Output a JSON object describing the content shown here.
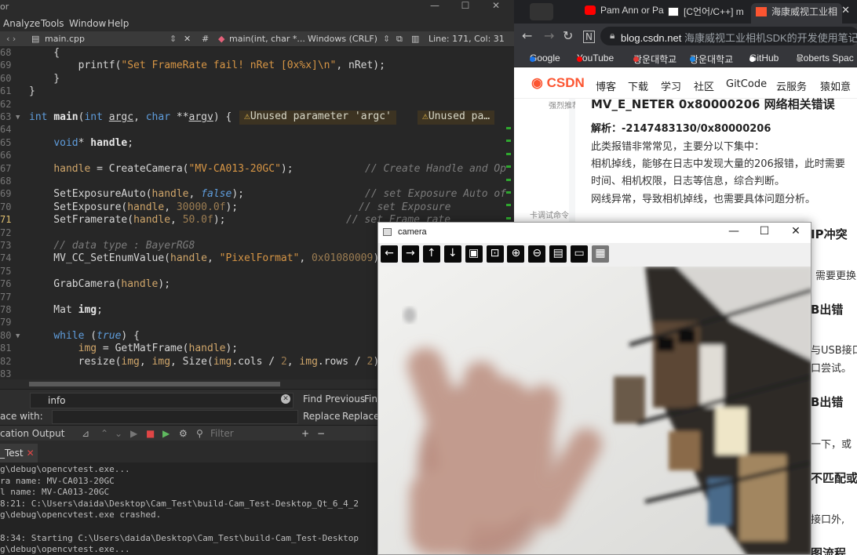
{
  "ide": {
    "title_fragment": "or",
    "menu": [
      "Analyze",
      "Tools",
      "Window",
      "Help"
    ],
    "editbar": {
      "file": "main.cpp",
      "symbol": "main(int, char *...",
      "line_ending": "Windows (CRLF)",
      "position": "Line: 171, Col: 31",
      "hash": "#"
    },
    "lines": [
      {
        "n": "68",
        "code": "    {"
      },
      {
        "n": "69",
        "code": "        printf(\"Set FrameRate fail! nRet [0x%x]\\n\", nRet);"
      },
      {
        "n": "60",
        "code": "    }"
      },
      {
        "n": "61",
        "code": "}"
      },
      {
        "n": "62",
        "code": ""
      },
      {
        "n": "63",
        "code": "int main(int argc, char **argv) {"
      },
      {
        "n": "64",
        "code": ""
      },
      {
        "n": "65",
        "code": "    void* handle;"
      },
      {
        "n": "66",
        "code": ""
      },
      {
        "n": "67",
        "code": "    handle = CreateCamera(\"MV-CA013-20GC\");"
      },
      {
        "n": "68",
        "code": ""
      },
      {
        "n": "69",
        "code": "    SetExposureAuto(handle, false);"
      },
      {
        "n": "70",
        "code": "    SetExposure(handle, 30000.0f);"
      },
      {
        "n": "71",
        "code": "    SetFramerate(handle, 50.0f);"
      },
      {
        "n": "72",
        "code": ""
      },
      {
        "n": "73",
        "code": "    // data type : BayerRG8"
      },
      {
        "n": "74",
        "code": "    MV_CC_SetEnumValue(handle, \"PixelFormat\", 0x01080009)"
      },
      {
        "n": "75",
        "code": ""
      },
      {
        "n": "76",
        "code": "    GrabCamera(handle);"
      },
      {
        "n": "77",
        "code": ""
      },
      {
        "n": "78",
        "code": "    Mat img;"
      },
      {
        "n": "79",
        "code": ""
      },
      {
        "n": "80",
        "code": "    while (true) {"
      },
      {
        "n": "81",
        "code": "        img = GetMatFrame(handle);"
      },
      {
        "n": "82",
        "code": "        resize(img, img, Size(img.cols / 2, img.rows / 2))"
      },
      {
        "n": "83",
        "code": ""
      }
    ],
    "comments": {
      "c67": "// Create Handle and Op",
      "c69": "// set Exposure Auto of",
      "c70": "// set Exposure",
      "c71": "// set Frame rate",
      "c73": "// data type : BayerRG8"
    },
    "warnings": [
      "Unused parameter 'argc'",
      "Unused pa…"
    ],
    "find": {
      "query": "info",
      "find_previous": "Find Previous",
      "find_next": "Find",
      "replace": "Replace",
      "replace_all": "Replace &",
      "replace_with": "ace with:"
    },
    "output_bar": {
      "title": "cation Output",
      "filter_placeholder": "Filter"
    },
    "output_tab": "_Test",
    "output_lines": [
      "g\\debug\\opencvtest.exe...",
      "ra name: MV-CA013-20GC",
      "l name: MV-CA013-20GC",
      "8:21: C:\\Users\\daida\\Desktop\\Cam_Test\\build-Cam_Test-Desktop_Qt_6_4_2",
      "g\\debug\\opencvtest.exe crashed.",
      "",
      "8:34: Starting C:\\Users\\daida\\Desktop\\Cam_Test\\build-Cam_Test-Desktop",
      "g\\debug\\opencvtest.exe..."
    ]
  },
  "browser": {
    "tabs": [
      "Pam Ann or Pa",
      "[C언어/C++] m",
      "海康威视工业相"
    ],
    "url_host": "blog.csdn.net",
    "url_rest": " 海康威视工业相机SDK的开发使用笔记_海",
    "bookmarks": [
      "Google",
      "YouTube",
      "광운대학교",
      "광운대학교",
      "GitHub",
      "Roberts Spac"
    ],
    "bookmark_colors": [
      "#1a73e8",
      "#ff0000",
      "#e53935",
      "#1e88e5",
      "#ffffff",
      "#888888"
    ],
    "csdn_logo": "CSDN",
    "csdn_nav": [
      "博客",
      "下载",
      "学习",
      "社区",
      "GitCode",
      "云服务",
      "猿如意"
    ],
    "article": {
      "heading_top": "MV_E_NETER 0x80000206 网络相关错误",
      "analysis": "解析：-2147483130/0x80000206",
      "p1": "此类报错非常常见，主要分以下集中：",
      "p2": "相机掉线，能够在日志中发现大量的206报错，此时需要",
      "p3": "时间、相机权限，日志等信息，综合判断。",
      "p4": "网线异常，导致相机掉线，也需要具体问题分析。",
      "h_ip": "IP冲突",
      "p_ip": "需要更换",
      "h_b": "B出错",
      "p_usb1": "与USB接口",
      "p_usb2": "口尝试。",
      "h_b2": "B出错",
      "p_try": "一下，或",
      "h_mismatch": "不匹配或",
      "p_port": "接口外,",
      "h_flow": "图流程",
      "side_items": [
        "强烈推荐",
        "卡调试命令"
      ]
    }
  },
  "camera": {
    "title": "camera",
    "tools": [
      "arrow-left-icon",
      "arrow-right-icon",
      "arrow-up-icon",
      "arrow-down-icon",
      "image-icon",
      "image-settings-icon",
      "zoom-in-icon",
      "zoom-out-icon",
      "save-icon",
      "clipboard-icon",
      "properties-icon"
    ]
  }
}
